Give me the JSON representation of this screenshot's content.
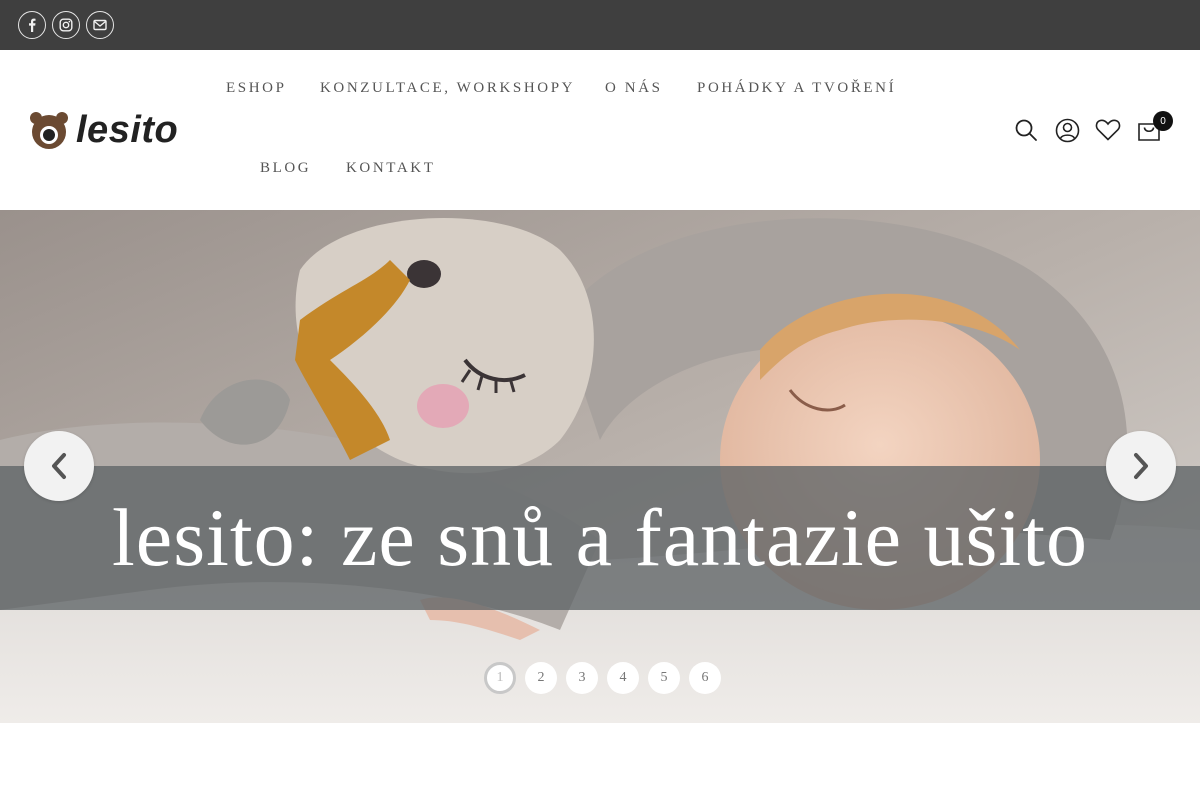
{
  "social": {
    "items": [
      {
        "icon": "facebook-icon"
      },
      {
        "icon": "instagram-icon"
      },
      {
        "icon": "email-icon"
      }
    ]
  },
  "header": {
    "logo_text": "lesito",
    "logo_icon": "bear-face-icon",
    "nav": [
      {
        "label": "ESHOP"
      },
      {
        "label": "KONZULTACE, WORKSHOPY"
      },
      {
        "label": "O NÁS"
      },
      {
        "label": "POHÁDKY A TVOŘENÍ"
      },
      {
        "label": "BLOG"
      },
      {
        "label": "KONTAKT"
      }
    ],
    "icons": [
      "search-icon",
      "user-icon",
      "heart-icon",
      "cart-icon"
    ],
    "cart_count": "0"
  },
  "hero": {
    "caption": "lesito: ze snů a fantazie ušito",
    "prev_icon": "chevron-left-icon",
    "next_icon": "chevron-right-icon",
    "slides": [
      "1",
      "2",
      "3",
      "4",
      "5",
      "6"
    ],
    "active_slide": "1"
  },
  "colors": {
    "topbar": "#3f3f3f",
    "caption_band": "#5f6466",
    "nav_text": "#555555",
    "badge": "#111111"
  }
}
